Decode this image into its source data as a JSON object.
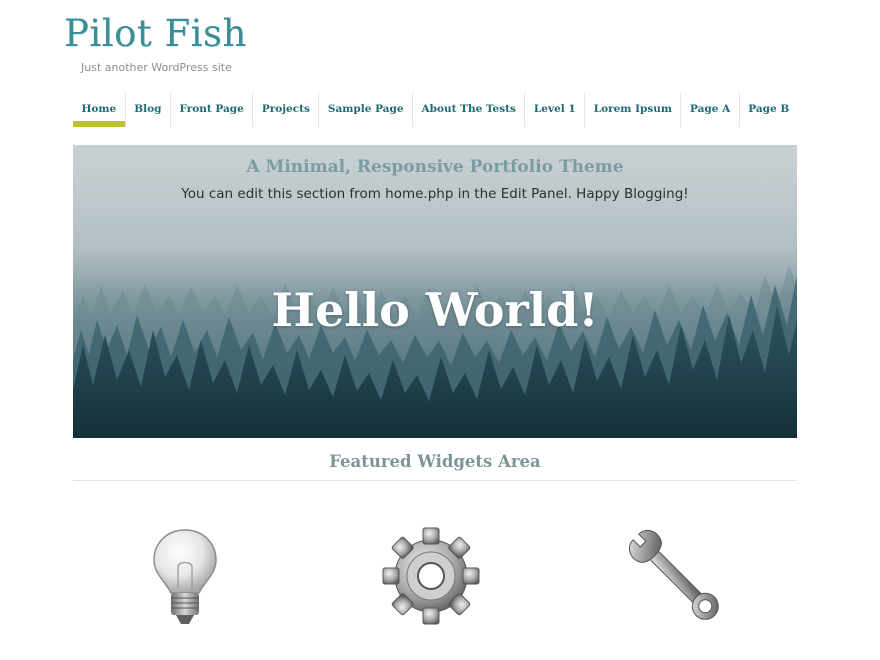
{
  "site": {
    "title": "Pilot Fish",
    "tagline": "Just another WordPress site"
  },
  "nav": {
    "items": [
      {
        "label": "Home",
        "active": true
      },
      {
        "label": "Blog"
      },
      {
        "label": "Front Page"
      },
      {
        "label": "Projects"
      },
      {
        "label": "Sample Page"
      },
      {
        "label": "About The Tests"
      },
      {
        "label": "Level 1"
      },
      {
        "label": "Lorem Ipsum"
      },
      {
        "label": "Page A"
      },
      {
        "label": "Page B"
      }
    ]
  },
  "hero": {
    "subtitle": "A Minimal, Responsive Portfolio Theme",
    "description": "You can edit this section from home.php in the Edit Panel. Happy Blogging!",
    "heading": "Hello World!"
  },
  "widgets": {
    "title": "Featured Widgets Area",
    "icons": [
      "lightbulb-icon",
      "gear-icon",
      "wrench-icon"
    ]
  },
  "colors": {
    "title": "#3a8f97",
    "nav_text": "#1e6a73",
    "active_underline": "#bfc12f",
    "widgets_title": "#7d9598"
  }
}
